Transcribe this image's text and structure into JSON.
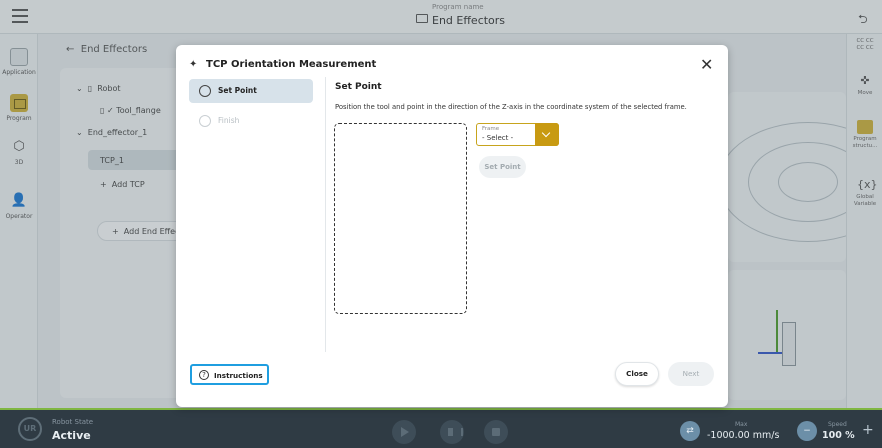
{
  "topbar": {
    "program_label": "Program name",
    "program_name": "End Effectors"
  },
  "left_nav": {
    "items": [
      {
        "label": "Application"
      },
      {
        "label": "Program"
      },
      {
        "label": "3D"
      },
      {
        "label": "Operator"
      }
    ]
  },
  "right_nav": {
    "items": [
      {
        "label": "CC CC\nCC CC"
      },
      {
        "label": "Move"
      },
      {
        "label": "Program\nstructu..."
      },
      {
        "label": "Global\nVariable"
      }
    ]
  },
  "background": {
    "header": "End Effectors",
    "tree": {
      "robot": "Robot",
      "tool_flange": "Tool_flange",
      "end_effector": "End_effector_1",
      "tcp": "TCP_1",
      "add_tcp": "Add TCP",
      "add_end_effector": "Add End Effec"
    }
  },
  "dialog": {
    "title": "TCP Orientation Measurement",
    "steps": [
      {
        "label": "Set Point",
        "active": true
      },
      {
        "label": "Finish",
        "active": false
      }
    ],
    "section_heading": "Set Point",
    "description": "Position the tool and point in the direction of the Z-axis in the coordinate system of the selected frame.",
    "frame_select": {
      "label": "Frame",
      "value": "- Select -"
    },
    "set_point_button": "Set Point",
    "instructions_button": "Instructions",
    "close_button": "Close",
    "next_button": "Next"
  },
  "bottombar": {
    "robot_state_label": "Robot State",
    "robot_state_value": "Active",
    "max_label": "Max",
    "max_value": "-1000.00 mm/s",
    "speed_label": "Speed",
    "speed_value": "100 %"
  },
  "colors": {
    "accent_gold": "#c89a12",
    "focus_blue": "#1f9ee0",
    "status_green": "#7fb642",
    "bottombar_bg": "#2f3b44"
  }
}
